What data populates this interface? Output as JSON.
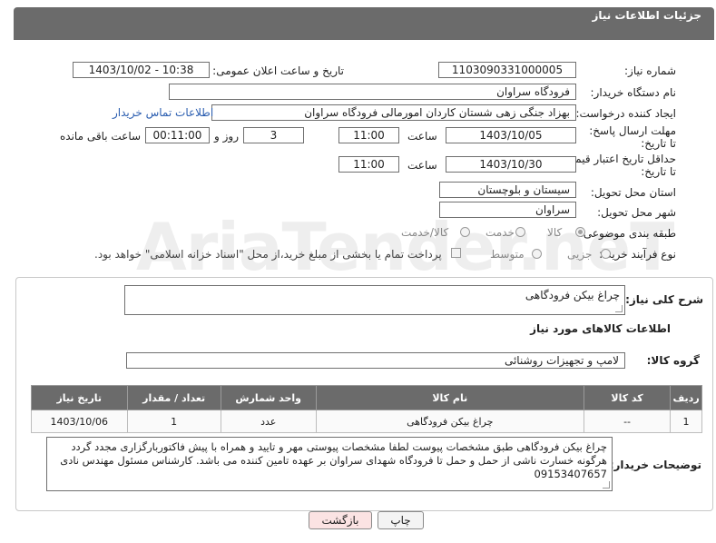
{
  "header": {
    "title": "جزئیات اطلاعات نیاز"
  },
  "fields": {
    "need_number_label": "شماره نیاز:",
    "need_number": "1103090331000005",
    "announce_label": "تاریخ و ساعت اعلان عمومی:",
    "announce_value": "1403/10/02 - 10:38",
    "buyer_org_label": "نام دستگاه خریدار:",
    "buyer_org": "فرودگاه سراوان",
    "requester_label": "ایجاد کننده درخواست:",
    "requester": "بهزاد جنگی زهی شستان کاردان امورمالی فرودگاه سراوان",
    "buyer_contact_link": "اطلاعات تماس خریدار",
    "reply_deadline_label": "مهلت ارسال پاسخ: تا تاریخ:",
    "reply_date": "1403/10/05",
    "time_label": "ساعت",
    "reply_time": "11:00",
    "days_value": "3",
    "days_label": "روز و",
    "remaining_time": "00:11:00",
    "remaining_label": "ساعت باقی مانده",
    "price_validity_label": "حداقل تاریخ اعتبار قیمت: تا تاریخ:",
    "price_date": "1403/10/30",
    "price_time": "11:00",
    "province_label": "استان محل تحویل:",
    "province": "سیستان و بلوچستان",
    "city_label": "شهر محل تحویل:",
    "city": "سراوان",
    "category_label": "طبقه بندی موضوعی:",
    "category_options": [
      "کالا",
      "خدمت",
      "کالا/خدمت"
    ],
    "process_label": "نوع فرآیند خرید :",
    "process_options": [
      "جزیی",
      "متوسط"
    ],
    "payment_note": "پرداخت تمام یا بخشی از مبلغ خرید،از محل \"اسناد خزانه اسلامی\" خواهد بود."
  },
  "watermark": "AriaTender.neT",
  "details": {
    "summary_label": "شرح کلی نیاز:",
    "summary": "چراغ بیکن فرودگاهی",
    "goods_info_title": "اطلاعات کالاهای مورد نیاز",
    "goods_group_label": "گروه کالا:",
    "goods_group": "لامپ و تجهیزات روشنائی",
    "table": {
      "headers": [
        "ردیف",
        "کد کالا",
        "نام کالا",
        "واحد شمارش",
        "تعداد / مقدار",
        "تاریخ نیاز"
      ],
      "rows": [
        [
          "1",
          "--",
          "چراغ بیکن فرودگاهی",
          "عدد",
          "1",
          "1403/10/06"
        ]
      ]
    },
    "buyer_notes_label": "توضیحات خریدار:",
    "buyer_notes": "چراغ بیکن فرودگاهی طبق مشخصات پیوست لطفا مشخصات پیوستی مهر و تایید و  همراه با پیش فاکتوربارگزاری مجدد گردد هرگونه خسارت ناشی از حمل و حمل تا فرودگاه شهدای سراوان بر عهده تامین کننده می باشد. کارشناس مسئول مهندس نادی 09153407657"
  },
  "buttons": {
    "print": "چاپ",
    "back": "بازگشت"
  },
  "colors": {
    "header_bg": "#6b6b6b",
    "link": "#2a5db0",
    "back_button_bg": "#fbe3e3"
  }
}
